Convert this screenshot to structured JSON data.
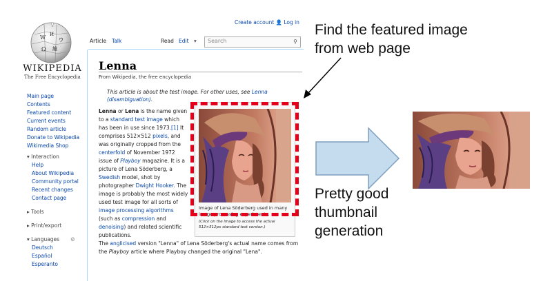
{
  "wiki": {
    "logo": {
      "wordmark": "WIKIPEDIA",
      "tagline": "The Free Encyclopedia"
    },
    "top_links": {
      "create_account": "Create account",
      "login": "Log in"
    },
    "tabs": {
      "article": "Article",
      "talk": "Talk",
      "read": "Read",
      "edit": "Edit",
      "more": "▾"
    },
    "search": {
      "placeholder": "Search"
    },
    "sidebar": {
      "main": [
        "Main page",
        "Contents",
        "Featured content",
        "Current events",
        "Random article",
        "Donate to Wikipedia",
        "Wikimedia Shop"
      ],
      "interaction_heading": "Interaction",
      "interaction": [
        "Help",
        "About Wikipedia",
        "Community portal",
        "Recent changes",
        "Contact page"
      ],
      "tools": "Tools",
      "print_export": "Print/export",
      "languages_heading": "Languages",
      "languages": [
        "Deutsch",
        "Español",
        "Esperanto"
      ]
    },
    "article": {
      "title": "Lenna",
      "from": "From Wikipedia, the free encyclopedia",
      "hatnote_prefix": "This article is about the test image. For other uses, see ",
      "hatnote_link": "Lenna (disambiguation)",
      "hatnote_suffix": ".",
      "caption": "Image of Lena Söderberg used in many image processing experiments.",
      "caption_note": "(Click on the image to access the actual 512×512px standard test version.)",
      "para1_parts": [
        {
          "t": "Lenna",
          "b": true
        },
        {
          "t": " or "
        },
        {
          "t": "Lena",
          "b": true
        },
        {
          "t": " is the name given to a "
        },
        {
          "t": "standard test image",
          "l": true
        },
        {
          "t": " which has been in use since 1973."
        },
        {
          "t": "[1]",
          "l": true
        },
        {
          "t": " It comprises 512×512 "
        },
        {
          "t": "pixels",
          "l": true
        },
        {
          "t": ", and was originally cropped from the "
        },
        {
          "t": "centerfold",
          "l": true
        },
        {
          "t": " of November 1972 issue of "
        },
        {
          "t": "Playboy",
          "l": true,
          "i": true
        },
        {
          "t": " magazine. It is a picture of Lena Söderberg, a "
        },
        {
          "t": "Swedish",
          "l": true
        },
        {
          "t": " model, shot by photographer "
        },
        {
          "t": "Dwight Hooker",
          "l": true
        },
        {
          "t": ". The image is probably the most widely used test image for all sorts of "
        },
        {
          "t": "image processing algorithms",
          "l": true
        },
        {
          "t": " (such as "
        },
        {
          "t": "compression",
          "l": true
        },
        {
          "t": " and "
        },
        {
          "t": "denoising",
          "l": true
        },
        {
          "t": ") and related scientific publications."
        }
      ],
      "para2_parts": [
        {
          "t": "The "
        },
        {
          "t": "anglicised",
          "l": true
        },
        {
          "t": " version \"Lenna\" of Lena Söderberg's actual name comes from the "
        },
        {
          "t": "Playboy",
          "i": true
        },
        {
          "t": " article where Playboy changed the original \"Lena\"."
        }
      ]
    }
  },
  "annotations": {
    "top": [
      "Find the featured image",
      "from web page"
    ],
    "bottom": [
      "Pretty good",
      "thumbnail",
      "generation"
    ]
  },
  "colors": {
    "dash": "#e4001b",
    "arrow_fill": "#c5dcef",
    "arrow_stroke": "#7f9fbf",
    "link": "#0645ad"
  }
}
